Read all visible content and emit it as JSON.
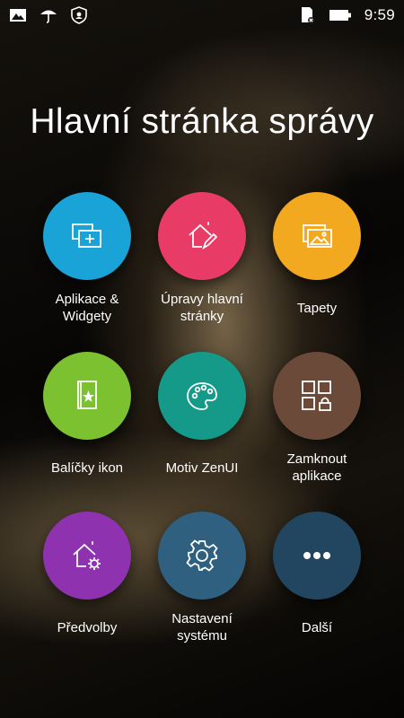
{
  "status_bar": {
    "left_icons": [
      "gallery-icon",
      "umbrella-icon",
      "shield-icon"
    ],
    "right_icons": [
      "sd-card-icon",
      "battery-icon"
    ],
    "time": "9:59"
  },
  "title": "Hlavní stránka správy",
  "tiles": [
    {
      "label": "Aplikace &\nWidgety",
      "icon": "apps-widgets-icon",
      "color": "#1aa3d6"
    },
    {
      "label": "Úpravy hlavní\nstránky",
      "icon": "edit-home-icon",
      "color": "#e83c66"
    },
    {
      "label": "Tapety",
      "icon": "wallpaper-icon",
      "color": "#f2a81f"
    },
    {
      "label": "Balíčky ikon",
      "icon": "icon-pack-icon",
      "color": "#7cc130"
    },
    {
      "label": "Motiv ZenUI",
      "icon": "palette-icon",
      "color": "#159a8a"
    },
    {
      "label": "Zamknout\naplikace",
      "icon": "app-lock-icon",
      "color": "#6b4a3a"
    },
    {
      "label": "Předvolby",
      "icon": "home-settings-icon",
      "color": "#8e32b0"
    },
    {
      "label": "Nastavení\nsystému",
      "icon": "gear-icon",
      "color": "#2f607f"
    },
    {
      "label": "Další",
      "icon": "more-icon",
      "color": "#22465f"
    }
  ]
}
